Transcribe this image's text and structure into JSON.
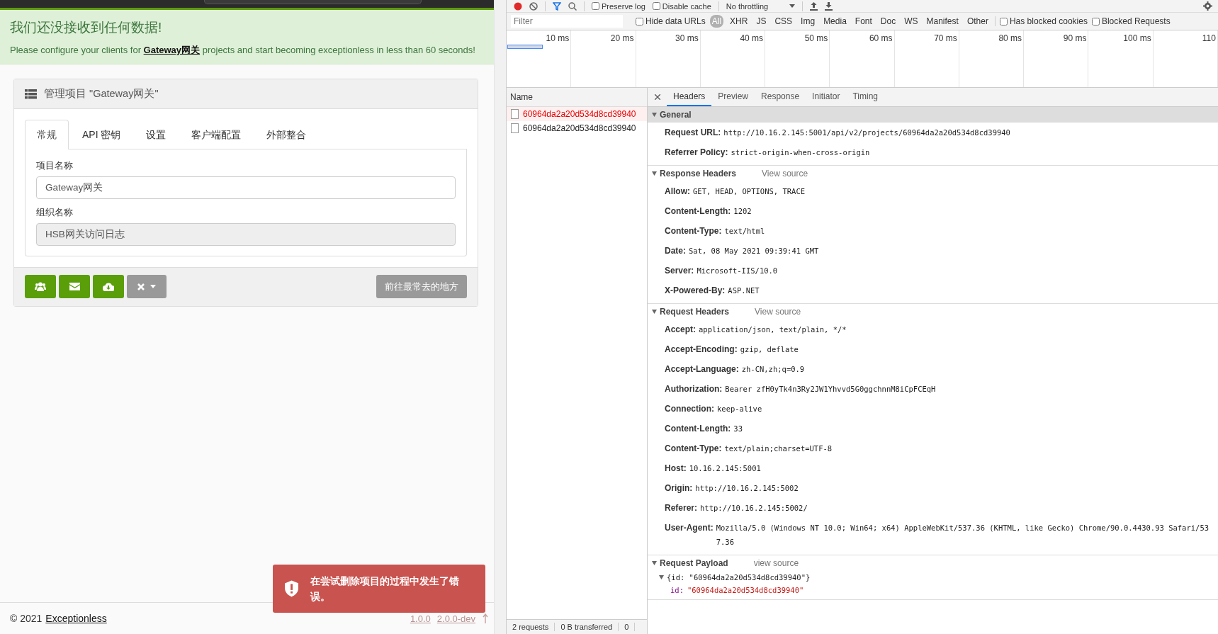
{
  "page": {
    "alert": {
      "title": "我们还没接收到任何数据!",
      "text_before": "Please configure your clients for ",
      "link": "Gateway网关",
      "text_after": " projects and start becoming exceptionless in less than 60 seconds!"
    },
    "panel": {
      "title": "管理项目 \"Gateway网关\"",
      "tabs": [
        {
          "label": "常规",
          "selected": true
        },
        {
          "label": "API 密钥",
          "selected": false
        },
        {
          "label": "设置",
          "selected": false
        },
        {
          "label": "客户端配置",
          "selected": false
        },
        {
          "label": "外部整合",
          "selected": false
        }
      ],
      "fields": [
        {
          "label": "项目名称",
          "value": "Gateway网关",
          "disabled": false
        },
        {
          "label": "组织名称",
          "value": "HSB网关访问日志",
          "disabled": true
        }
      ],
      "action_buttons": [
        {
          "kind": "users"
        },
        {
          "kind": "mail"
        },
        {
          "kind": "download"
        },
        {
          "kind": "delete-menu"
        }
      ],
      "link_button": "前往最常去的地方"
    },
    "footer": {
      "copyright": "© 2021",
      "link": "Exceptionless",
      "versions": [
        "1.0.0",
        "2.0.0-dev"
      ]
    },
    "toast": {
      "message": "在尝试删除项目的过程中发生了错误。"
    }
  },
  "devtools": {
    "toolbar": {
      "checkboxes": [
        {
          "label": "Preserve log",
          "checked": false
        },
        {
          "label": "Disable cache",
          "checked": false
        }
      ],
      "throttling": "No throttling"
    },
    "filter": {
      "placeholder": "Filter",
      "hide_data_urls": {
        "label": "Hide data URLs",
        "checked": false
      },
      "types": [
        {
          "label": "All",
          "selected": true
        },
        {
          "label": "XHR",
          "selected": false
        },
        {
          "label": "JS",
          "selected": false
        },
        {
          "label": "CSS",
          "selected": false
        },
        {
          "label": "Img",
          "selected": false
        },
        {
          "label": "Media",
          "selected": false
        },
        {
          "label": "Font",
          "selected": false
        },
        {
          "label": "Doc",
          "selected": false
        },
        {
          "label": "WS",
          "selected": false
        },
        {
          "label": "Manifest",
          "selected": false
        },
        {
          "label": "Other",
          "selected": false
        }
      ],
      "checkboxes": [
        {
          "label": "Has blocked cookies",
          "checked": false
        },
        {
          "label": "Blocked Requests",
          "checked": false
        }
      ]
    },
    "timeline": {
      "ticks": [
        "10 ms",
        "20 ms",
        "30 ms",
        "40 ms",
        "50 ms",
        "60 ms",
        "70 ms",
        "80 ms",
        "90 ms",
        "100 ms",
        "110"
      ]
    },
    "requests": {
      "column": "Name",
      "rows": [
        {
          "name": "60964da2a20d534d8cd39940",
          "error": true
        },
        {
          "name": "60964da2a20d534d8cd39940",
          "error": false
        }
      ]
    },
    "status_bar": [
      "2 requests",
      "0 B transferred",
      "0"
    ],
    "detail_tabs": [
      {
        "label": "Headers",
        "selected": true
      },
      {
        "label": "Preview",
        "selected": false
      },
      {
        "label": "Response",
        "selected": false
      },
      {
        "label": "Initiator",
        "selected": false
      },
      {
        "label": "Timing",
        "selected": false
      }
    ],
    "sections": [
      {
        "kind": "headers",
        "title": "General",
        "selected": true,
        "expanded": true,
        "rows": [
          {
            "name": "Request URL:",
            "value": "http://10.16.2.145:5001/api/v2/projects/60964da2a20d534d8cd39940"
          },
          {
            "name": "Referrer Policy:",
            "value": "strict-origin-when-cross-origin"
          }
        ]
      },
      {
        "kind": "headers",
        "title": "Response Headers",
        "source_link": "View source",
        "selected": false,
        "expanded": true,
        "rows": [
          {
            "name": "Allow:",
            "value": "GET, HEAD, OPTIONS, TRACE"
          },
          {
            "name": "Content-Length:",
            "value": "1202"
          },
          {
            "name": "Content-Type:",
            "value": "text/html"
          },
          {
            "name": "Date:",
            "value": "Sat, 08 May 2021 09:39:41 GMT"
          },
          {
            "name": "Server:",
            "value": "Microsoft-IIS/10.0"
          },
          {
            "name": "X-Powered-By:",
            "value": "ASP.NET"
          }
        ]
      },
      {
        "kind": "headers",
        "title": "Request Headers",
        "source_link": "View source",
        "selected": false,
        "expanded": true,
        "rows": [
          {
            "name": "Accept:",
            "value": "application/json, text/plain, */*"
          },
          {
            "name": "Accept-Encoding:",
            "value": "gzip, deflate"
          },
          {
            "name": "Accept-Language:",
            "value": "zh-CN,zh;q=0.9"
          },
          {
            "name": "Authorization:",
            "value": "Bearer zfH0yTk4n3Ry2JW1Yhvvd5G0ggchnnM8iCpFCEqH"
          },
          {
            "name": "Connection:",
            "value": "keep-alive"
          },
          {
            "name": "Content-Length:",
            "value": "33"
          },
          {
            "name": "Content-Type:",
            "value": "text/plain;charset=UTF-8"
          },
          {
            "name": "Host:",
            "value": "10.16.2.145:5001"
          },
          {
            "name": "Origin:",
            "value": "http://10.16.2.145:5002"
          },
          {
            "name": "Referer:",
            "value": "http://10.16.2.145:5002/"
          },
          {
            "name": "User-Agent:",
            "value": "Mozilla/5.0 (Windows NT 10.0; Win64; x64) AppleWebKit/537.36 (KHTML, like Gecko) Chrome/90.0.4430.93 Safari/537.36"
          }
        ]
      },
      {
        "kind": "payload",
        "title": "Request Payload",
        "source_link": "view source",
        "selected": false,
        "expanded": true,
        "tree": {
          "summary": "{id: \"60964da2a20d534d8cd39940\"}",
          "expanded": true,
          "props": [
            {
              "key": "id:",
              "value": "\"60964da2a20d534d8cd39940\""
            }
          ]
        }
      }
    ]
  }
}
